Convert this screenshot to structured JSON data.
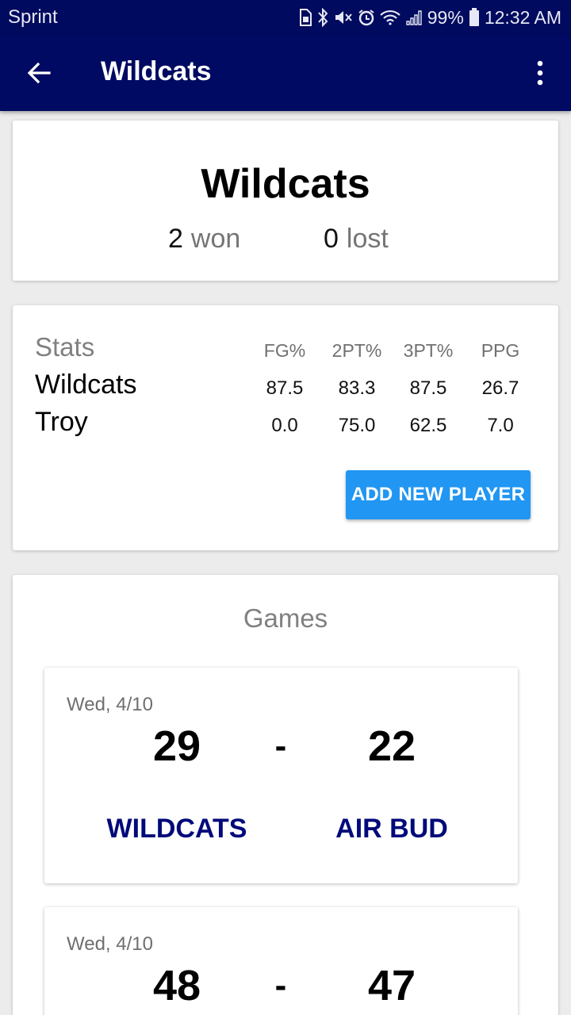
{
  "status_bar": {
    "carrier": "Sprint",
    "battery": "99%",
    "time": "12:32 AM",
    "icons": [
      "sim-icon",
      "bluetooth-icon",
      "mute-icon",
      "alarm-icon",
      "wifi-icon",
      "signal-icon",
      "battery-icon"
    ]
  },
  "app_bar": {
    "title": "Wildcats",
    "back_icon": "arrow-left-icon",
    "menu_icon": "more-vert-icon"
  },
  "team": {
    "name": "Wildcats",
    "won": "2",
    "won_label": "won",
    "lost": "0",
    "lost_label": "lost"
  },
  "stats": {
    "label": "Stats",
    "columns": [
      "FG%",
      "2PT%",
      "3PT%",
      "PPG"
    ],
    "rows": [
      {
        "name": "Wildcats",
        "values": [
          "87.5",
          "83.3",
          "87.5",
          "26.7"
        ]
      },
      {
        "name": "Troy",
        "values": [
          "0.0",
          "75.0",
          "62.5",
          "7.0"
        ]
      }
    ],
    "add_button": "ADD NEW PLAYER"
  },
  "games": {
    "title": "Games",
    "items": [
      {
        "date": "Wed, 4/10",
        "score_a": "29",
        "separator": "-",
        "score_b": "22",
        "team_a": "WILDCATS",
        "team_b": "AIR BUD"
      },
      {
        "date": "Wed, 4/10",
        "score_a": "48",
        "separator": "-",
        "score_b": "47",
        "team_a": "",
        "team_b": ""
      }
    ]
  },
  "colors": {
    "status_bar": "#000a5e",
    "app_bar": "#000a62",
    "accent_button": "#2196f3",
    "team_link": "#000a7a"
  }
}
